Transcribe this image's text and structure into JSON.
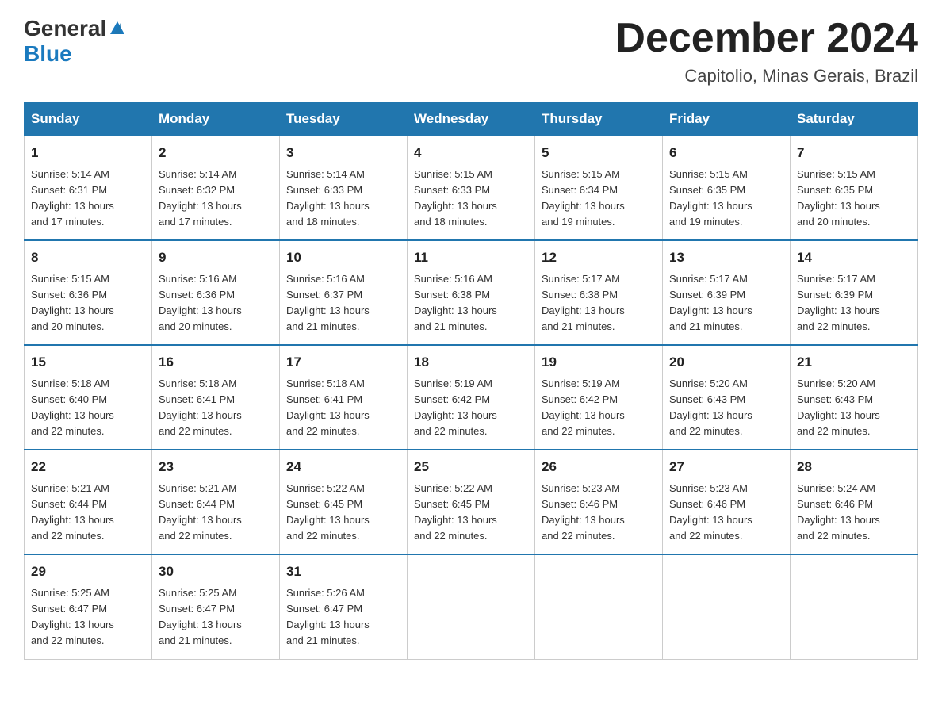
{
  "logo": {
    "general": "General",
    "blue": "Blue"
  },
  "title": "December 2024",
  "location": "Capitolio, Minas Gerais, Brazil",
  "headers": [
    "Sunday",
    "Monday",
    "Tuesday",
    "Wednesday",
    "Thursday",
    "Friday",
    "Saturday"
  ],
  "weeks": [
    [
      {
        "day": "1",
        "sunrise": "5:14 AM",
        "sunset": "6:31 PM",
        "daylight": "13 hours and 17 minutes."
      },
      {
        "day": "2",
        "sunrise": "5:14 AM",
        "sunset": "6:32 PM",
        "daylight": "13 hours and 17 minutes."
      },
      {
        "day": "3",
        "sunrise": "5:14 AM",
        "sunset": "6:33 PM",
        "daylight": "13 hours and 18 minutes."
      },
      {
        "day": "4",
        "sunrise": "5:15 AM",
        "sunset": "6:33 PM",
        "daylight": "13 hours and 18 minutes."
      },
      {
        "day": "5",
        "sunrise": "5:15 AM",
        "sunset": "6:34 PM",
        "daylight": "13 hours and 19 minutes."
      },
      {
        "day": "6",
        "sunrise": "5:15 AM",
        "sunset": "6:35 PM",
        "daylight": "13 hours and 19 minutes."
      },
      {
        "day": "7",
        "sunrise": "5:15 AM",
        "sunset": "6:35 PM",
        "daylight": "13 hours and 20 minutes."
      }
    ],
    [
      {
        "day": "8",
        "sunrise": "5:15 AM",
        "sunset": "6:36 PM",
        "daylight": "13 hours and 20 minutes."
      },
      {
        "day": "9",
        "sunrise": "5:16 AM",
        "sunset": "6:36 PM",
        "daylight": "13 hours and 20 minutes."
      },
      {
        "day": "10",
        "sunrise": "5:16 AM",
        "sunset": "6:37 PM",
        "daylight": "13 hours and 21 minutes."
      },
      {
        "day": "11",
        "sunrise": "5:16 AM",
        "sunset": "6:38 PM",
        "daylight": "13 hours and 21 minutes."
      },
      {
        "day": "12",
        "sunrise": "5:17 AM",
        "sunset": "6:38 PM",
        "daylight": "13 hours and 21 minutes."
      },
      {
        "day": "13",
        "sunrise": "5:17 AM",
        "sunset": "6:39 PM",
        "daylight": "13 hours and 21 minutes."
      },
      {
        "day": "14",
        "sunrise": "5:17 AM",
        "sunset": "6:39 PM",
        "daylight": "13 hours and 22 minutes."
      }
    ],
    [
      {
        "day": "15",
        "sunrise": "5:18 AM",
        "sunset": "6:40 PM",
        "daylight": "13 hours and 22 minutes."
      },
      {
        "day": "16",
        "sunrise": "5:18 AM",
        "sunset": "6:41 PM",
        "daylight": "13 hours and 22 minutes."
      },
      {
        "day": "17",
        "sunrise": "5:18 AM",
        "sunset": "6:41 PM",
        "daylight": "13 hours and 22 minutes."
      },
      {
        "day": "18",
        "sunrise": "5:19 AM",
        "sunset": "6:42 PM",
        "daylight": "13 hours and 22 minutes."
      },
      {
        "day": "19",
        "sunrise": "5:19 AM",
        "sunset": "6:42 PM",
        "daylight": "13 hours and 22 minutes."
      },
      {
        "day": "20",
        "sunrise": "5:20 AM",
        "sunset": "6:43 PM",
        "daylight": "13 hours and 22 minutes."
      },
      {
        "day": "21",
        "sunrise": "5:20 AM",
        "sunset": "6:43 PM",
        "daylight": "13 hours and 22 minutes."
      }
    ],
    [
      {
        "day": "22",
        "sunrise": "5:21 AM",
        "sunset": "6:44 PM",
        "daylight": "13 hours and 22 minutes."
      },
      {
        "day": "23",
        "sunrise": "5:21 AM",
        "sunset": "6:44 PM",
        "daylight": "13 hours and 22 minutes."
      },
      {
        "day": "24",
        "sunrise": "5:22 AM",
        "sunset": "6:45 PM",
        "daylight": "13 hours and 22 minutes."
      },
      {
        "day": "25",
        "sunrise": "5:22 AM",
        "sunset": "6:45 PM",
        "daylight": "13 hours and 22 minutes."
      },
      {
        "day": "26",
        "sunrise": "5:23 AM",
        "sunset": "6:46 PM",
        "daylight": "13 hours and 22 minutes."
      },
      {
        "day": "27",
        "sunrise": "5:23 AM",
        "sunset": "6:46 PM",
        "daylight": "13 hours and 22 minutes."
      },
      {
        "day": "28",
        "sunrise": "5:24 AM",
        "sunset": "6:46 PM",
        "daylight": "13 hours and 22 minutes."
      }
    ],
    [
      {
        "day": "29",
        "sunrise": "5:25 AM",
        "sunset": "6:47 PM",
        "daylight": "13 hours and 22 minutes."
      },
      {
        "day": "30",
        "sunrise": "5:25 AM",
        "sunset": "6:47 PM",
        "daylight": "13 hours and 21 minutes."
      },
      {
        "day": "31",
        "sunrise": "5:26 AM",
        "sunset": "6:47 PM",
        "daylight": "13 hours and 21 minutes."
      },
      null,
      null,
      null,
      null
    ]
  ],
  "labels": {
    "sunrise": "Sunrise:",
    "sunset": "Sunset:",
    "daylight": "Daylight:"
  }
}
